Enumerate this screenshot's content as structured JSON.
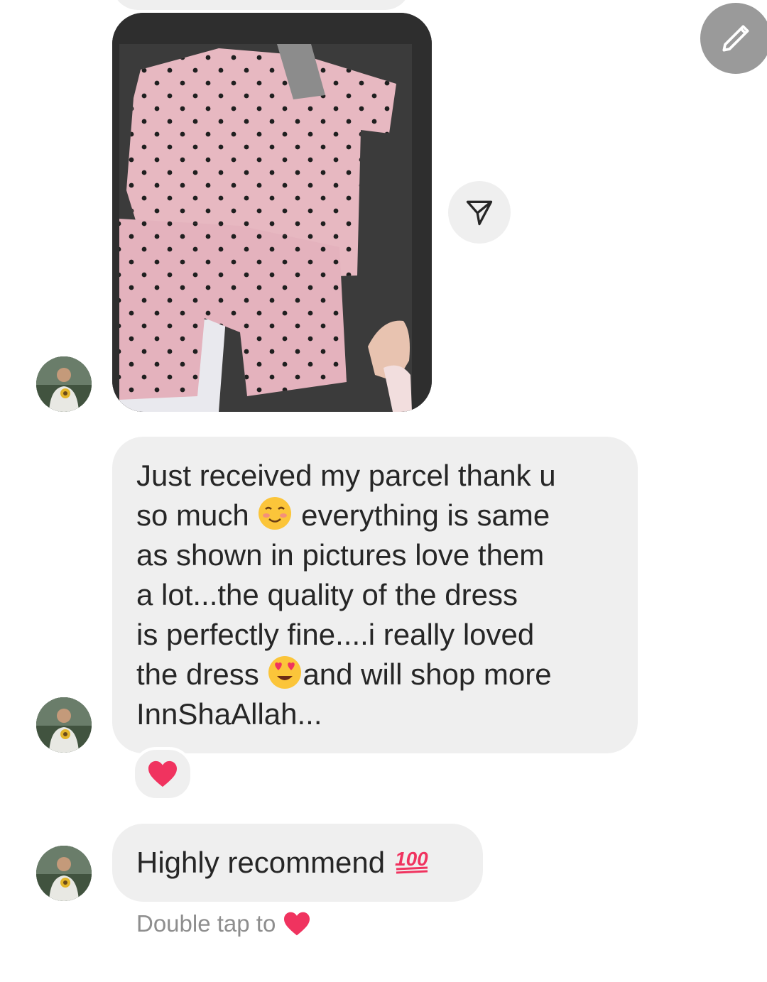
{
  "messages": {
    "long_text": "Just received my parcel thank u so much ☺️ everything is same as shown in pictures love them a lot...the quality of the dress is perfectly fine....i really loved the dress 😍and will shop more InnShaAllah...",
    "long_lines": [
      "Just received my parcel thank u",
      "so much",
      "everything is same",
      "as shown in pictures love them",
      "a lot...the quality of the dress",
      "is perfectly fine....i really loved",
      "the dress",
      "and will shop more",
      "InnShaAllah..."
    ],
    "short_text": "Highly recommend",
    "short_emoji": "💯",
    "reaction_emoji": "❤️"
  },
  "hint": {
    "text": "Double tap to",
    "emoji": "❤️"
  },
  "icons": {
    "edit": "pencil-icon",
    "share": "send-icon",
    "reaction": "heart-icon"
  },
  "colors": {
    "bubble": "#efefef",
    "heart": "#f0335f",
    "fab": "#9a9a9a"
  }
}
